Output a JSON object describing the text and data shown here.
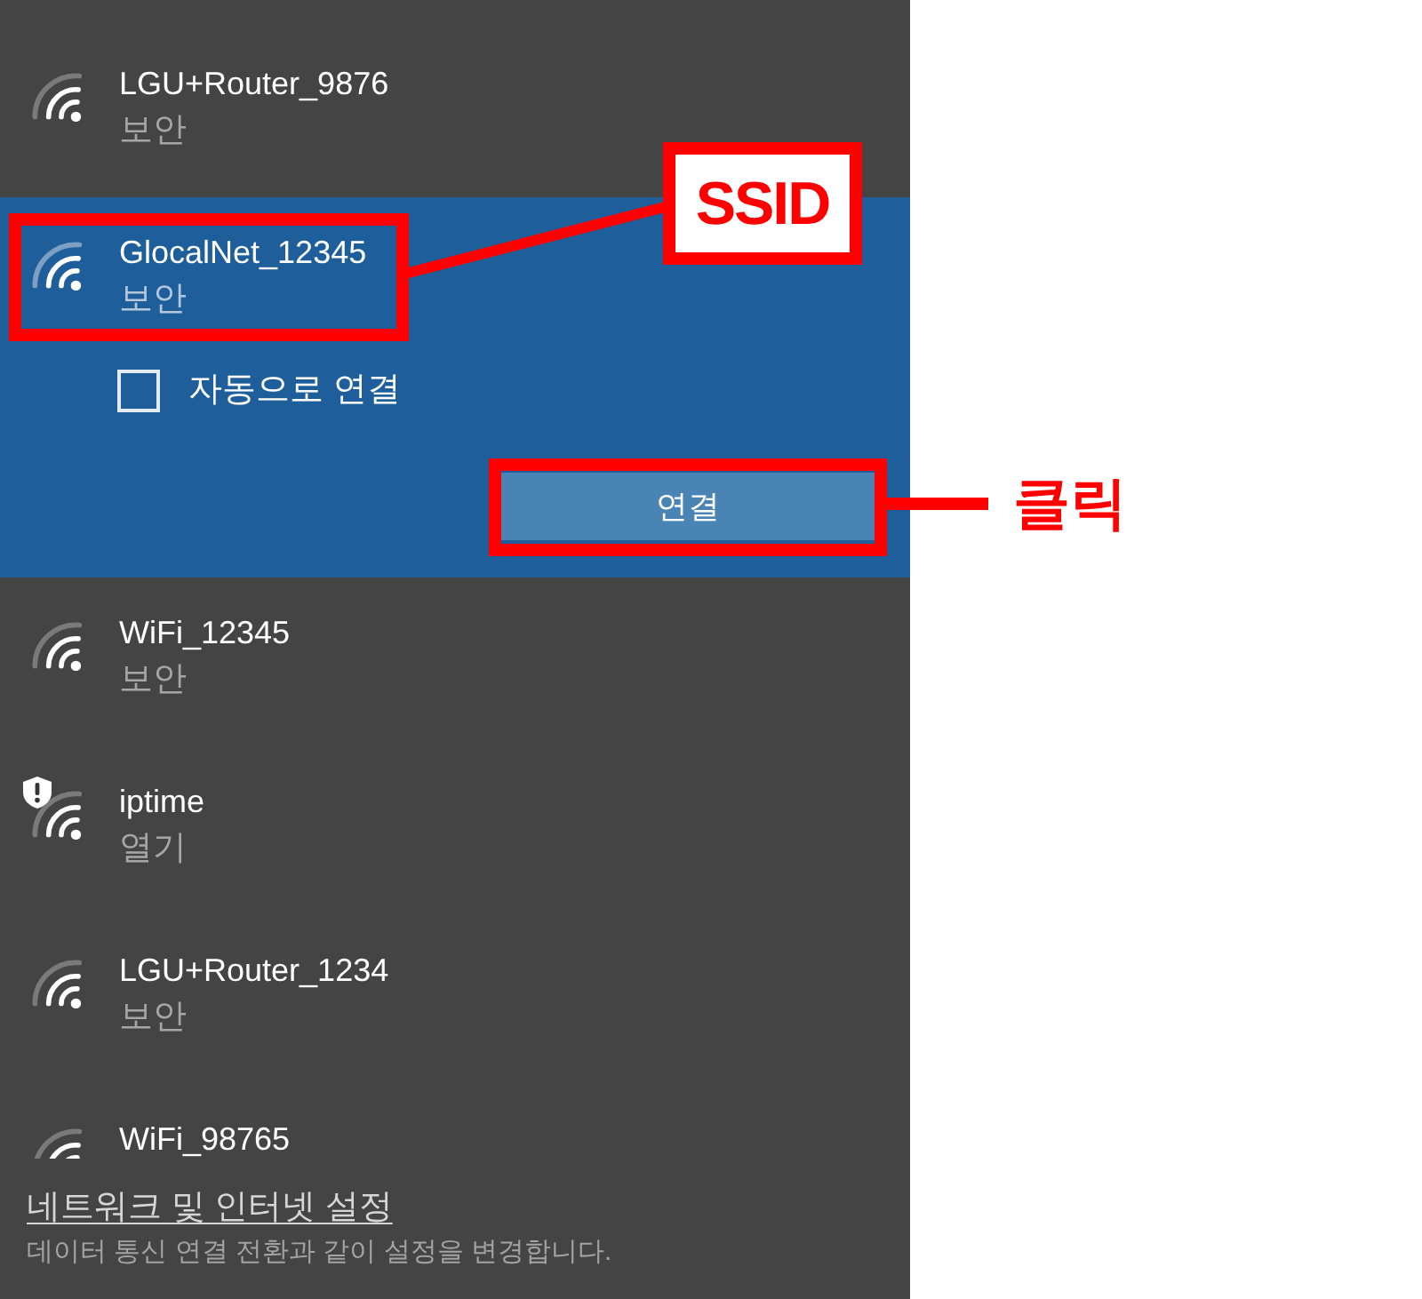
{
  "networks": [
    {
      "name": "LGU+Router_9876",
      "status": "보안",
      "selected": false,
      "warning": false
    },
    {
      "name": "GlocalNet_12345",
      "status": "보안",
      "selected": true,
      "warning": false,
      "auto_connect": {
        "label": "자동으로 연결",
        "checked": false
      },
      "connect_button": "연결"
    },
    {
      "name": "WiFi_12345",
      "status": "보안",
      "selected": false,
      "warning": false
    },
    {
      "name": "iptime",
      "status": "열기",
      "selected": false,
      "warning": true
    },
    {
      "name": "LGU+Router_1234",
      "status": "보안",
      "selected": false,
      "warning": false
    },
    {
      "name": "WiFi_98765",
      "selected": false,
      "warning": false
    }
  ],
  "footer": {
    "link": "네트워크 및 인터넷 설정",
    "description": "데이터 통신 연결 전환과 같이 설정을 변경합니다."
  },
  "annotations": [
    {
      "kind": "callout",
      "text": "SSID"
    },
    {
      "kind": "click_label",
      "text": "클릭"
    }
  ]
}
